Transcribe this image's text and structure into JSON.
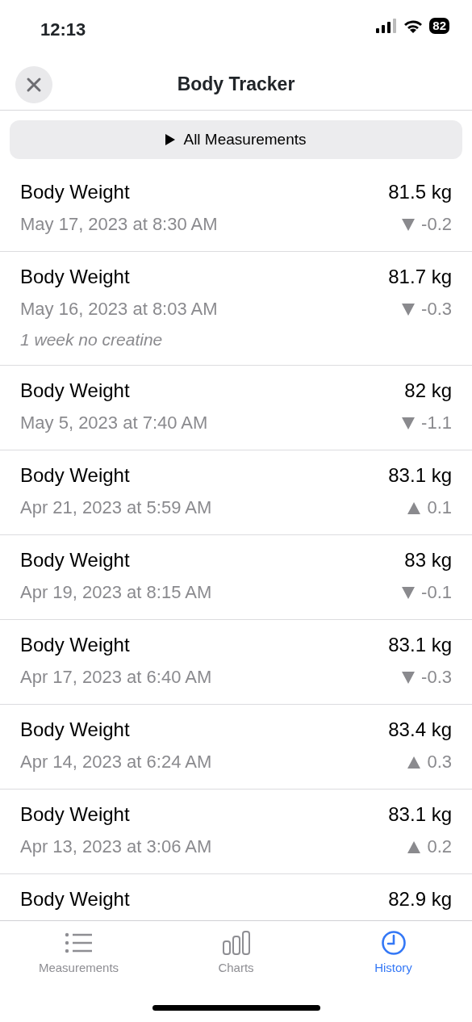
{
  "status_bar": {
    "time": "12:13",
    "battery": "82"
  },
  "header": {
    "title": "Body Tracker"
  },
  "filter": {
    "label": "All Measurements"
  },
  "entries": [
    {
      "name": "Body Weight",
      "value": "81.5 kg",
      "date": "May 17, 2023 at 8:30 AM",
      "kind": "down",
      "change": "-0.2"
    },
    {
      "name": "Body Weight",
      "value": "81.7 kg",
      "date": "May 16, 2023 at 8:03 AM",
      "kind": "down",
      "change": "-0.3",
      "note": "1 week no creatine"
    },
    {
      "name": "Body Weight",
      "value": "82 kg",
      "date": "May 5, 2023 at 7:40 AM",
      "kind": "down",
      "change": "-1.1"
    },
    {
      "name": "Body Weight",
      "value": "83.1 kg",
      "date": "Apr 21, 2023 at 5:59 AM",
      "kind": "up",
      "change": "0.1"
    },
    {
      "name": "Body Weight",
      "value": "83 kg",
      "date": "Apr 19, 2023 at 8:15 AM",
      "kind": "down",
      "change": "-0.1"
    },
    {
      "name": "Body Weight",
      "value": "83.1 kg",
      "date": "Apr 17, 2023 at 6:40 AM",
      "kind": "down",
      "change": "-0.3"
    },
    {
      "name": "Body Weight",
      "value": "83.4 kg",
      "date": "Apr 14, 2023 at 6:24 AM",
      "kind": "up",
      "change": "0.3"
    },
    {
      "name": "Body Weight",
      "value": "83.1 kg",
      "date": "Apr 13, 2023 at 3:06 AM",
      "kind": "up",
      "change": "0.2"
    },
    {
      "name": "Body Weight",
      "value": "82.9 kg"
    }
  ],
  "tabs": [
    {
      "label": "Measurements",
      "kind": "list",
      "selected": false
    },
    {
      "label": "Charts",
      "kind": "bars",
      "selected": false
    },
    {
      "label": "History",
      "kind": "clock",
      "selected": true
    }
  ]
}
